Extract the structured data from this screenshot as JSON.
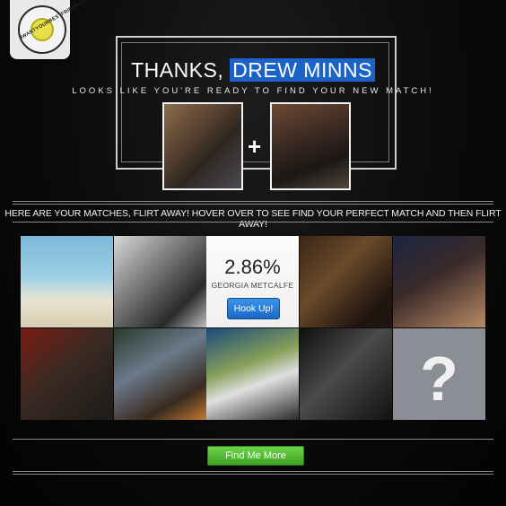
{
  "logo": {
    "text": "IWANTYOURBESTFRIEND.COM"
  },
  "header": {
    "title_prefix": "THANKS,",
    "user_name": "DREW MINNS",
    "subtitle": "LOOKS LIKE YOU'RE READY TO FIND YOUR NEW MATCH!",
    "plus_symbol": "+"
  },
  "matches": {
    "instruction": "HERE ARE YOUR MATCHES, FLIRT AWAY! HOVER OVER TO SEE FIND YOUR PERFECT MATCH AND THEN FLIRT AWAY!",
    "hover_card": {
      "percentage": "2.86%",
      "name": "GEORGIA METCALFE",
      "button_label": "Hook Up!"
    },
    "unknown_symbol": "?"
  },
  "footer": {
    "more_button_label": "Find Me More"
  },
  "colors": {
    "name_highlight": "#1b63c9",
    "hook_button": "#1a68c8",
    "more_button": "#3ea323",
    "unknown_tile": "#8c8e96"
  }
}
